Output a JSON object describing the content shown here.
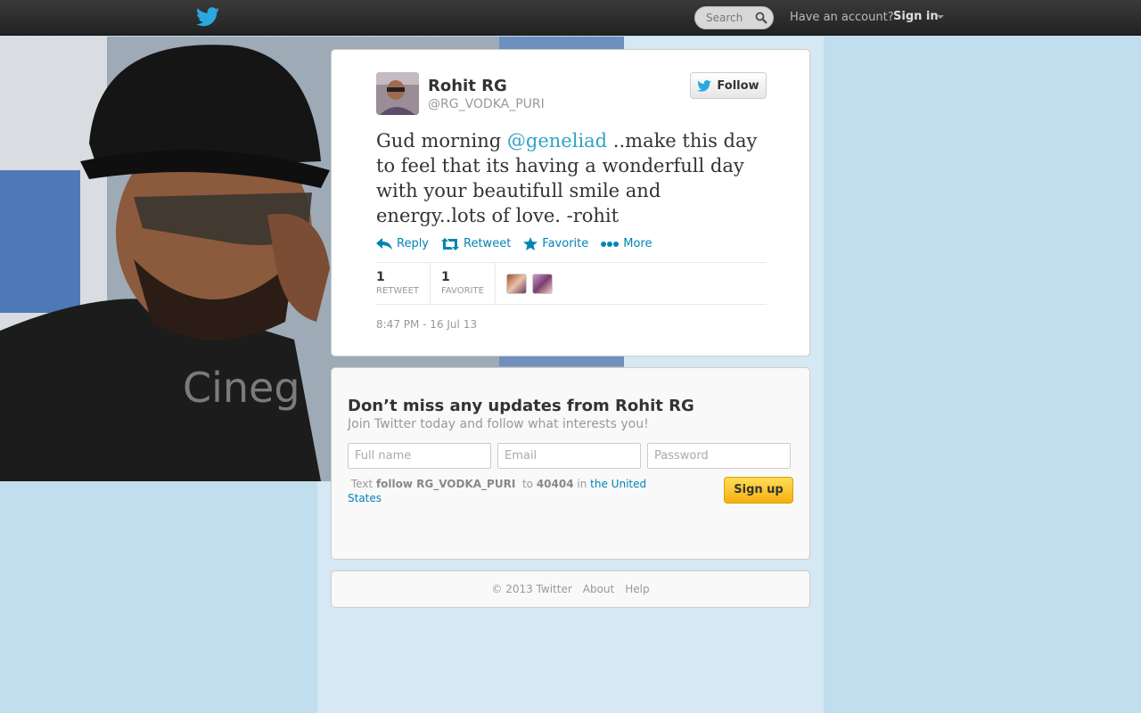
{
  "topbar": {
    "search_placeholder": "Search",
    "have_account": "Have an account?",
    "sign_in": "Sign in"
  },
  "tweet": {
    "name": "Rohit RG",
    "handle": "@RG_VODKA_PURI",
    "follow_label": "Follow",
    "text_before": "Gud morning ",
    "mention": "@geneliad",
    "text_after": " ..make this day to feel that its having a wonderfull day  with your beautifull smile and energy..lots of love. -rohit",
    "actions": {
      "reply": "Reply",
      "retweet": "Retweet",
      "favorite": "Favorite",
      "more": "More"
    },
    "stats": {
      "retweet_count": "1",
      "retweet_label": "RETWEET",
      "favorite_count": "1",
      "favorite_label": "FAVORITE"
    },
    "timestamp": "8:47 PM - 16 Jul 13"
  },
  "signup": {
    "title": "Don’t miss any updates from Rohit RG",
    "subtitle": "Join Twitter today and follow what interests you!",
    "fullname_placeholder": "Full name",
    "email_placeholder": "Email",
    "password_placeholder": "Password",
    "sms_text": "Text",
    "sms_command": "follow RG_VODKA_PURI",
    "sms_to": "to",
    "sms_number": "40404",
    "sms_in": "in",
    "sms_country": "the United States",
    "button": "Sign up"
  },
  "footer": {
    "copyright": "© 2013 Twitter",
    "about": "About",
    "help": "Help"
  },
  "colors": {
    "accent": "#0084b4",
    "mention": "#2fa3c7",
    "background": "#c0deed"
  }
}
